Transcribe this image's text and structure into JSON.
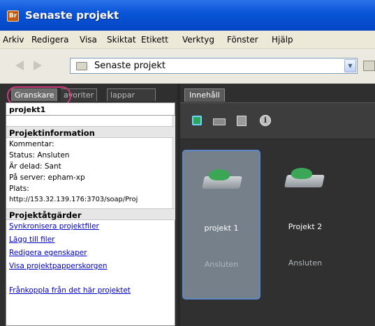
{
  "window": {
    "title": "Senaste projekt",
    "app_icon": "Br"
  },
  "menu": [
    "Arkiv",
    "Redigera",
    "Visa",
    "Skiktat",
    "Etikett",
    "Verktyg",
    "Fönster",
    "Hjälp"
  ],
  "path": {
    "value": "Senaste projekt"
  },
  "left_tabs": [
    "Granskare",
    "avoriter",
    "lappar"
  ],
  "panel": {
    "header": "projekt1",
    "info_title": "Projektinformation",
    "info_lines": [
      "Kommentar:",
      "Status: Ansluten",
      "Är delad: Sant",
      "På server: epham-xp",
      "Plats:",
      "http://153.32.139.176:3703/soap/Proj"
    ],
    "actions_title": "Projektåtgärder",
    "actions": [
      "Synkronisera projektfiler",
      "Lägg till filer",
      "Redigera egenskaper",
      "Visa projektpapperskorgen"
    ],
    "disconnect": "Frånkoppla från det här projektet"
  },
  "content": {
    "tab": "Innehåll",
    "toolbar_icons": [
      "new-project-icon",
      "tray-settings-icon",
      "file-stack-icon",
      "info-icon"
    ],
    "info_glyph": "i",
    "projects": [
      {
        "name": "projekt 1",
        "status": "Ansluten",
        "selected": true
      },
      {
        "name": "Projekt 2",
        "status": "Ansluten",
        "selected": false
      }
    ]
  },
  "colors": {
    "titlebar": "#0a55d8",
    "highlight_ring": "#cc3a79",
    "link": "#0000cc",
    "selection": "#76808a"
  }
}
